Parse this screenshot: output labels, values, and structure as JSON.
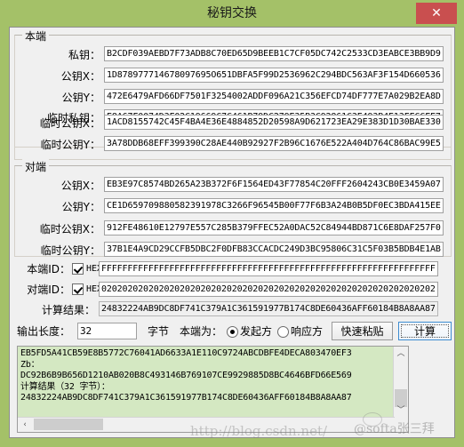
{
  "window": {
    "title": "秘钥交换",
    "close_label": "✕",
    "accent_green": "#a4c168",
    "close_red": "#c94f4f",
    "output_bg": "#d4e8c2"
  },
  "local_group": {
    "legend": "本端",
    "fields": [
      {
        "label": "私钥：",
        "value": "B2CDF039AEBD7F73ADB8C70ED65D9BEEB1C7CF05DC742C2533CD3EABCE3BB9D9"
      },
      {
        "label": "公钥X：",
        "value": "1D878977714678097695O651DBFA5F99D2536962C294BDC563AF3F154D660536"
      },
      {
        "label": "公钥Y：",
        "value": "472E6479AFD66DF7501F3254002ADDF096A21C356EFCD74DF777E7A029B2EA8D"
      }
    ],
    "temp_fields": [
      {
        "label": "临时私钥：",
        "value": "E8A67F0074D3F02C19669C7C461B79DC279E35B3C92861C3E493B4E13FFCCFE7"
      },
      {
        "label": "临时公钥X：",
        "value": "1ACD8155742C45F4BA4E36E4884852D20598A9D621723EA29E383D1D30BAE330"
      },
      {
        "label": "临时公钥Y：",
        "value": "3A78DDB68EFF399390C28AE440B92927F2B96C1676E522A404D764C86BAC99E5"
      }
    ]
  },
  "peer_group": {
    "legend": "对端",
    "fields": [
      {
        "label": "公钥X：",
        "value": "EB3E97C8574BD265A23B372F6F1564ED43F77854C20FFF2604243CB0E3459A07"
      },
      {
        "label": "公钥Y：",
        "value": "CE1D659709880582391978C3266F96545B00F77F6B3A24B0B5DF0EC3BDA415EE"
      }
    ],
    "temp_fields": [
      {
        "label": "临时公钥X：",
        "value": "912FE48610E12797E557C285B379FFEC52A0DAC52C84944BD871C6E8DAF257F0"
      },
      {
        "label": "临时公钥Y：",
        "value": "37B1E4A9CD29CCFB5DBC2F0DFB83CCACDC249D3BC95806C31C5F03B5BDB4E1AB"
      }
    ]
  },
  "ids": {
    "local": {
      "label": "本端ID：",
      "hex_label": "HEX",
      "hex_checked": true,
      "value": "FFFFFFFFFFFFFFFFFFFFFFFFFFFFFFFFFFFFFFFFFFFFFFFFFFFFFFFFFFFFFFFF"
    },
    "peer": {
      "label": "对端ID：",
      "hex_label": "HEX",
      "hex_checked": true,
      "value": "0202020202020202020202020202020202020202020202020202020202020202"
    }
  },
  "result": {
    "label": "计算结果：",
    "value": "24832224AB9DC8DF741C379A1C361591977B174C8DE60436AFF60184B8A8AA87"
  },
  "bottom_bar": {
    "length_label": "输出长度：",
    "length_value": "32",
    "unit_label": "字节",
    "role_label": "本端为：",
    "radio_initiator": {
      "label": "发起方",
      "selected": true
    },
    "radio_responder": {
      "label": "响应方",
      "selected": false
    },
    "paste_button": "快速粘贴",
    "calc_button": "计算"
  },
  "output": {
    "text": "EB5FD5A41CB59E8B5772C76041AD6633A1E110C9724ABCDBFE4DECA803470EF3\nZb：\nDC92B6B9B656D1210AB020B8C493146B769107CE9929885D8BC4646BFD66E569\n计算结果（32 字节）：\n24832224AB9DC8DF741C379A1C361591977B174C8DE60436AFF60184B8A8AA87",
    "scroll_up": "︿",
    "scroll_down": "﹀",
    "scroll_left": "‹"
  },
  "watermark": {
    "url": "http://blog.csdn.net/",
    "user": "@softa张三拜"
  }
}
